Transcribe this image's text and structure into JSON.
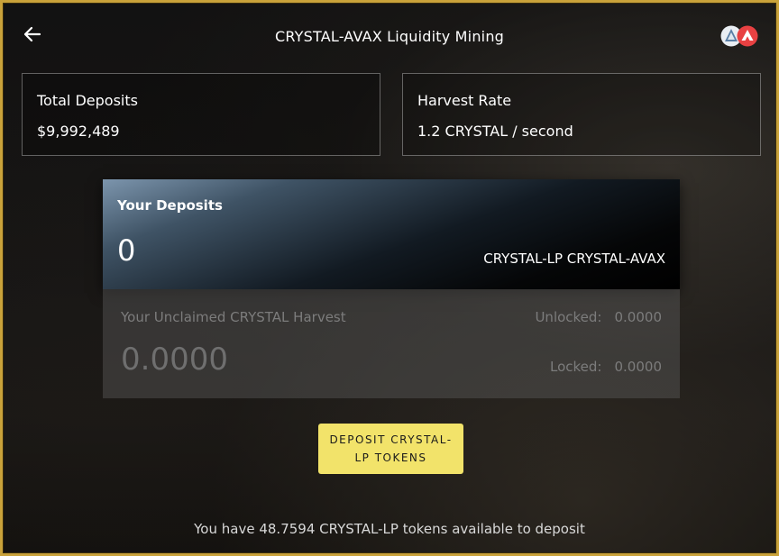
{
  "header": {
    "title": "CRYSTAL-AVAX Liquidity Mining"
  },
  "stats": {
    "total_deposits": {
      "label": "Total Deposits",
      "value": "$9,992,489"
    },
    "harvest_rate": {
      "label": "Harvest Rate",
      "value": "1.2 CRYSTAL / second"
    }
  },
  "your_deposits": {
    "label": "Your Deposits",
    "amount": "0",
    "token": "CRYSTAL-LP CRYSTAL-AVAX"
  },
  "harvest": {
    "label": "Your Unclaimed CRYSTAL Harvest",
    "amount": "0.0000",
    "unlocked_label": "Unlocked:",
    "unlocked_value": "0.0000",
    "locked_label": "Locked:",
    "locked_value": "0.0000"
  },
  "deposit_button": {
    "label": "DEPOSIT CRYSTAL-LP TOKENS"
  },
  "footer": {
    "available_text": "You have 48.7594 CRYSTAL-LP tokens available to deposit"
  },
  "icons": {
    "back": "arrow-left-icon",
    "chain1": "crystal-token-icon",
    "chain2": "avax-token-icon"
  },
  "colors": {
    "frame_border": "#c9a23a",
    "button_bg": "#f2e36a",
    "avax_red": "#e84142"
  }
}
